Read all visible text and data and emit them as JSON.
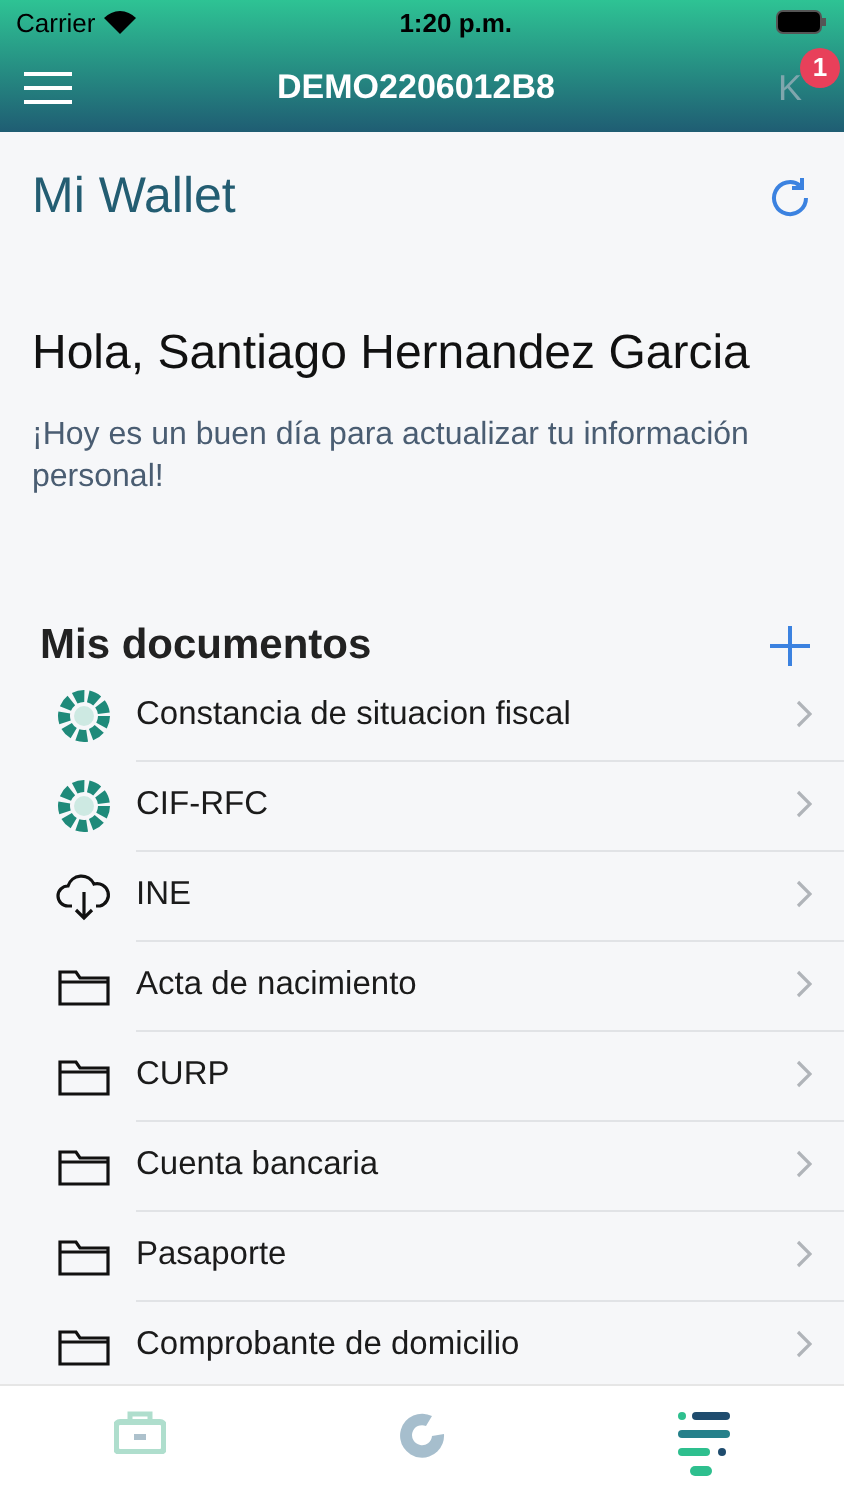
{
  "status_bar": {
    "carrier": "Carrier",
    "time": "1:20 p.m."
  },
  "nav": {
    "title": "DEMO2206012B8",
    "avatar_letter": "K",
    "badge": "1"
  },
  "header": {
    "title": "Mi Wallet"
  },
  "greeting": {
    "title": "Hola, Santiago Hernandez Garcia",
    "message": "¡Hoy es un buen día para actualizar tu información personal!"
  },
  "documents": {
    "title": "Mis documentos",
    "items": [
      {
        "label": "Constancia de situacion fiscal",
        "kind": "emblem"
      },
      {
        "label": "CIF-RFC",
        "kind": "emblem"
      },
      {
        "label": "INE",
        "kind": "cloud"
      },
      {
        "label": "Acta de nacimiento",
        "kind": "folder"
      },
      {
        "label": "CURP",
        "kind": "folder"
      },
      {
        "label": "Cuenta bancaria",
        "kind": "folder"
      },
      {
        "label": "Pasaporte",
        "kind": "folder"
      },
      {
        "label": "Comprobante de domicilio",
        "kind": "folder"
      }
    ]
  },
  "tab_bar": [
    {
      "kind": "wallet",
      "selected": false
    },
    {
      "kind": "progress",
      "selected": false
    },
    {
      "kind": "list",
      "selected": true
    }
  ]
}
